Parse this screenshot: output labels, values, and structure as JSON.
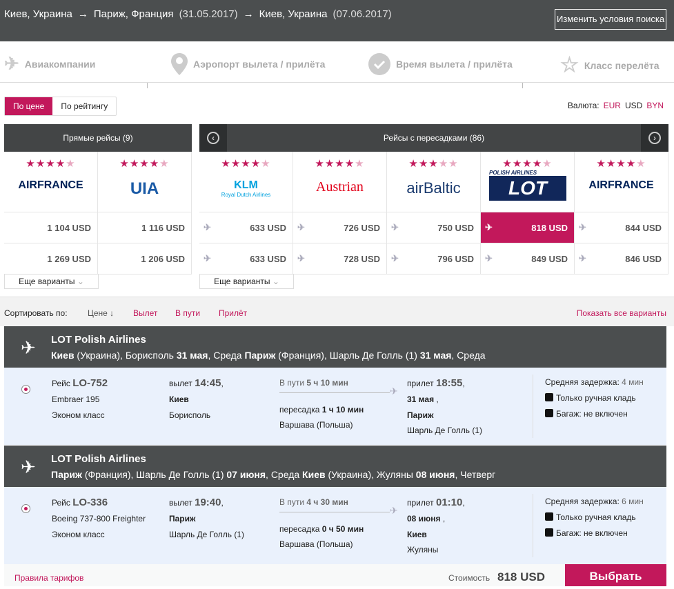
{
  "header": {
    "from": "Киев, Украина",
    "to": "Париж, Франция",
    "date_out": "(31.05.2017)",
    "back": "Киев, Украина",
    "date_back": "(07.06.2017)",
    "arrow": "→",
    "change_button": "Изменить условия поиска"
  },
  "filters": [
    {
      "label": "Авиакомпании",
      "icon": "plane-icon"
    },
    {
      "label": "Аэропорт вылета / прилёта",
      "icon": "pin-icon"
    },
    {
      "label": "Время вылета / прилёта",
      "icon": "check-icon"
    },
    {
      "label": "Класс перелёта",
      "icon": "star-icon"
    }
  ],
  "sort_toggle": {
    "price": "По цене",
    "rating": "По рейтингу"
  },
  "currency": {
    "label": "Валюта:",
    "options": [
      "EUR",
      "USD",
      "BYN"
    ],
    "selected": "USD"
  },
  "direct": {
    "title": "Прямые рейсы (9)",
    "more": "Еще варианты",
    "airlines": [
      {
        "name": "AIRFRANCE",
        "stars": 4,
        "color": "#002157",
        "prices": [
          "1 104 USD",
          "1 269 USD"
        ]
      },
      {
        "name": "UIA",
        "stars": 4,
        "color": "#1a5aa6",
        "prices": [
          "1 116 USD",
          "1 206 USD"
        ]
      }
    ]
  },
  "connecting": {
    "title": "Рейсы с пересадками (86)",
    "more": "Еще варианты",
    "airlines": [
      {
        "name": "KLM",
        "sub": "Royal Dutch Airlines",
        "stars": 4,
        "color": "#00a1de",
        "prices": [
          "633 USD",
          "633 USD"
        ]
      },
      {
        "name": "Austrian",
        "stars": 4,
        "color": "#e2001a",
        "prices": [
          "726 USD",
          "728 USD"
        ]
      },
      {
        "name": "airBaltic",
        "stars": 3.5,
        "color": "#1a3a6e",
        "prices": [
          "750 USD",
          "796 USD"
        ]
      },
      {
        "name": "LOT",
        "sub": "POLISH AIRLINES",
        "stars": 4,
        "color": "#11275a",
        "prices": [
          "818 USD",
          "849 USD"
        ],
        "selected": true
      },
      {
        "name": "AIRFRANCE",
        "stars": 4,
        "color": "#002157",
        "prices": [
          "844 USD",
          "846 USD"
        ]
      }
    ]
  },
  "sort": {
    "label": "Сортировать по:",
    "price": "Цене ↓",
    "dep": "Вылет",
    "dur": "В пути",
    "arr": "Прилёт",
    "show_all": "Показать все варианты"
  },
  "segments": [
    {
      "airline": "LOT Polish Airlines",
      "r": [
        "Киев",
        " (Украина), Борисполь ",
        "31 мая",
        ", Среда ",
        "Париж",
        " (Франция), Шарль Де Голль (1) ",
        "31 мая",
        ", Среда"
      ],
      "flight_label": "Рейс ",
      "flight": "LO-752",
      "aircraft": "Embraer 195",
      "class": "Эконом класс",
      "dep_label": "вылет ",
      "dep_time": "14:45",
      "dep_city": "Киев",
      "dep_airport": "Борисполь",
      "dur_label": "В пути ",
      "dur": "5 ч 10 мин",
      "transfer_label": "пересадка ",
      "transfer": "1 ч 10 мин",
      "transfer_city": "Варшава (Польша)",
      "arr_label": "прилет ",
      "arr_time": "18:55",
      "arr_date": "31 мая",
      "arr_city": "Париж",
      "arr_airport": "Шарль Де Голль (1)",
      "delay_label": "Средняя задержка: ",
      "delay": "4 мин",
      "hand": "Только ручная кладь",
      "bag": "Багаж: не включен"
    },
    {
      "airline": "LOT Polish Airlines",
      "r": [
        "Париж",
        " (Франция), Шарль Де Голль (1) ",
        "07 июня",
        ", Среда ",
        "Киев",
        " (Украина), Жуляны ",
        "08 июня",
        ", Четверг"
      ],
      "flight_label": "Рейс ",
      "flight": "LO-336",
      "aircraft": "Boeing 737-800 Freighter",
      "class": "Эконом класс",
      "dep_label": "вылет ",
      "dep_time": "19:40",
      "dep_city": "Париж",
      "dep_airport": "Шарль Де Голль (1)",
      "dur_label": "В пути ",
      "dur": "4 ч 30 мин",
      "transfer_label": "пересадка ",
      "transfer": "0 ч 50 мин",
      "transfer_city": "Варшава (Польша)",
      "arr_label": "прилет ",
      "arr_time": "01:10",
      "arr_date": "08 июня",
      "arr_city": "Киев",
      "arr_airport": "Жуляны",
      "delay_label": "Средняя задержка: ",
      "delay": "6 мин",
      "hand": "Только ручная кладь",
      "bag": "Багаж: не включен"
    }
  ],
  "footer": {
    "rules": "Правила тарифов",
    "cost_label": "Стоимость",
    "cost": "818 USD",
    "select": "Выбрать"
  },
  "colors": {
    "accent": "#c2185b",
    "header": "#4b4e4f"
  }
}
